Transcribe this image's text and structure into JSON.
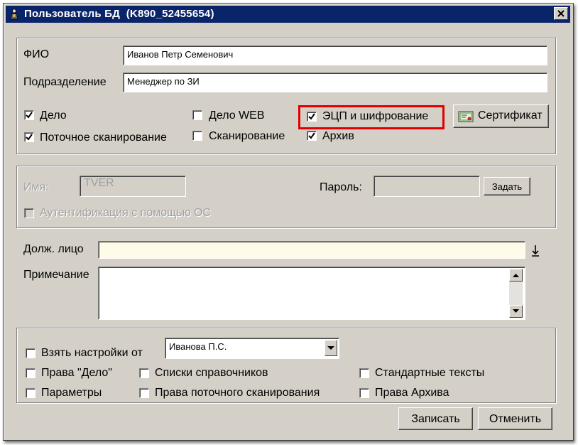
{
  "window": {
    "title": "Пользователь БД  (K890_52455654)"
  },
  "user": {
    "fio_label": "ФИО",
    "fio_value": "Иванов Петр Семенович",
    "division_label": "Подразделение",
    "division_value": "Менеджер по ЗИ"
  },
  "access": {
    "delo": {
      "label": "Дело",
      "checked": true
    },
    "stream_scan": {
      "label": "Поточное сканирование",
      "checked": true
    },
    "delo_web": {
      "label": "Дело WEB",
      "checked": false
    },
    "scanning": {
      "label": "Сканирование",
      "checked": false
    },
    "eds": {
      "label": "ЭЦП и шифрование",
      "checked": true
    },
    "archive": {
      "label": "Архив",
      "checked": true
    },
    "certificate_button": "Сертификат"
  },
  "login": {
    "name_label": "Имя:",
    "name_value": "TVER",
    "password_label": "Пароль:",
    "password_value": "",
    "set_button": "Задать",
    "os_auth": {
      "label": "Аутентификация с помощью ОС",
      "checked": false
    }
  },
  "official": {
    "label": "Долж. лицо",
    "value": "",
    "note_label": "Примечание",
    "note_value": ""
  },
  "copy_settings": {
    "take_label": "Взять настройки от",
    "take_checked": false,
    "source_user": "Иванова П.С.",
    "rights_delo": {
      "label": "Права \"Дело\"",
      "checked": false
    },
    "dictionaries": {
      "label": "Списки справочников",
      "checked": false
    },
    "std_texts": {
      "label": "Стандартные тексты",
      "checked": false
    },
    "params": {
      "label": "Параметры",
      "checked": false
    },
    "stream_rights": {
      "label": "Права поточного сканирования",
      "checked": false
    },
    "archive_rights": {
      "label": "Права Архива",
      "checked": false
    }
  },
  "footer": {
    "save_button": "Записать",
    "cancel_button": "Отменить"
  },
  "colors": {
    "titlebar": "#0a246a",
    "face": "#d4d0c8",
    "highlight": "#e00000",
    "official_field": "#fffbe9"
  }
}
